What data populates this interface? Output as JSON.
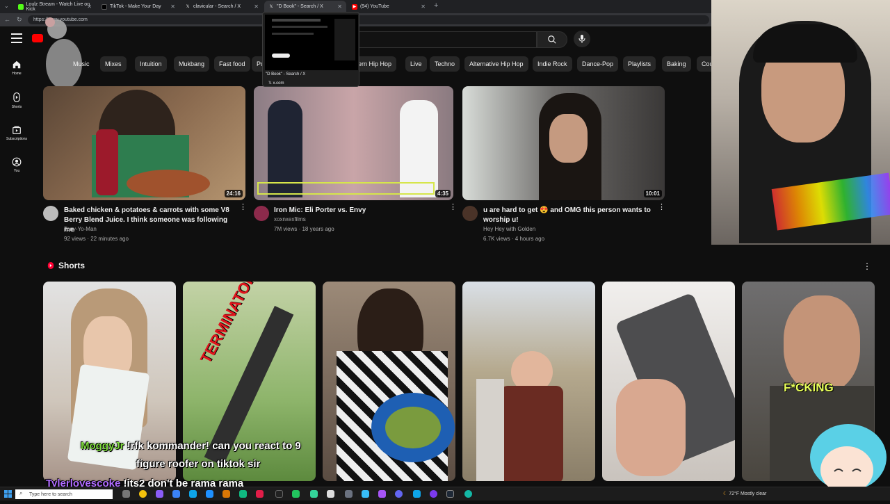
{
  "browser": {
    "tabs": [
      {
        "label": "Loulz Stream - Watch Live on Kick",
        "color": "#53fc18",
        "icon": "kick-icon"
      },
      {
        "label": "TikTok - Make Your Day",
        "color": "#000000",
        "icon": "tiktok-icon"
      },
      {
        "label": "clavicular - Search / X",
        "color": "#000000",
        "icon": "x-icon"
      },
      {
        "label": "\"D Book\" - Search / X",
        "color": "#000000",
        "icon": "x-icon"
      },
      {
        "label": "(94) YouTube",
        "color": "#ff0000",
        "icon": "youtube-icon"
      }
    ],
    "url": "https://www.youtube.com",
    "preview": {
      "title": "\"D Book\" - Search / X",
      "url": "x.com"
    }
  },
  "sidebar": [
    {
      "label": "Home",
      "icon": "home-icon"
    },
    {
      "label": "Shorts",
      "icon": "shorts-icon"
    },
    {
      "label": "Subscriptions",
      "icon": "subscriptions-icon"
    },
    {
      "label": "You",
      "icon": "you-icon"
    }
  ],
  "chips": [
    "Music",
    "Mixes",
    "Intuition",
    "Mukbang",
    "Fast food",
    "Po",
    "ern Hip Hop",
    "Live",
    "Techno",
    "Alternative Hip Hop",
    "Indie Rock",
    "Dance-Pop",
    "Playlists",
    "Baking",
    "Cou"
  ],
  "videos": [
    {
      "title_line1": "Baked chicken & potatoes & carrots with some V8",
      "title_line2": "Berry Blend Juice. I think someone was following me",
      "channel": "Tony-Yo-Man",
      "meta": "92 views · 22 minutes ago",
      "duration": "24:16",
      "accent": "#8a6a4f"
    },
    {
      "title_line1": "Iron Mic: Eli Porter vs. Envy",
      "title_line2": "",
      "channel": "xoxnxexfilms",
      "meta": "7M views · 18 years ago",
      "duration": "4:35",
      "accent": "#a98b8e"
    },
    {
      "title_line1": "u are hard to get 😍 and OMG this person wants to",
      "title_line2": "worship u!",
      "channel": "Hey Hey with Golden",
      "meta": "6.7K views · 4 hours ago",
      "duration": "10:01",
      "accent": "#6f6d6b"
    }
  ],
  "shorts": {
    "title": "Shorts",
    "overlay_texts": [
      "TERMINATOR",
      "F*CKING"
    ]
  },
  "chat": [
    {
      "user": "MoggyJr",
      "user_color": "#7fdc3f",
      "message": "!rfk kommander! can you react to 9",
      "message2": "figure roofer on tiktok sir"
    },
    {
      "user": "Tylerlovescoke",
      "user_color": "#b06bff",
      "message": "!its2 don't be rama rama"
    }
  ],
  "taskbar": {
    "search_placeholder": "Type here to search",
    "weather": "72°F  Mostly clear"
  }
}
